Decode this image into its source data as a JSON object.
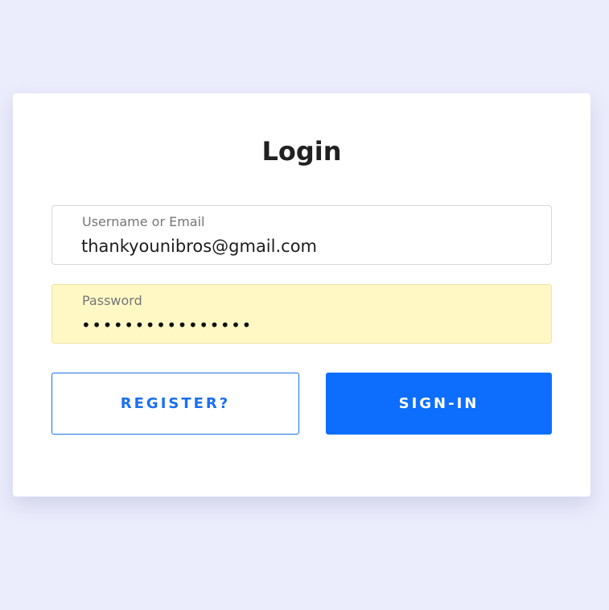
{
  "login": {
    "title": "Login",
    "username": {
      "label": "Username or Email",
      "value": "thankyounibros@gmail.com"
    },
    "password": {
      "label": "Password",
      "value": "••••••••••••••••",
      "autofill_color": "#fff8c5"
    },
    "register_button": "REGISTER?",
    "signin_button": "SIGN-IN"
  },
  "colors": {
    "background": "#ebecfc",
    "accent": "#0d6efd"
  }
}
